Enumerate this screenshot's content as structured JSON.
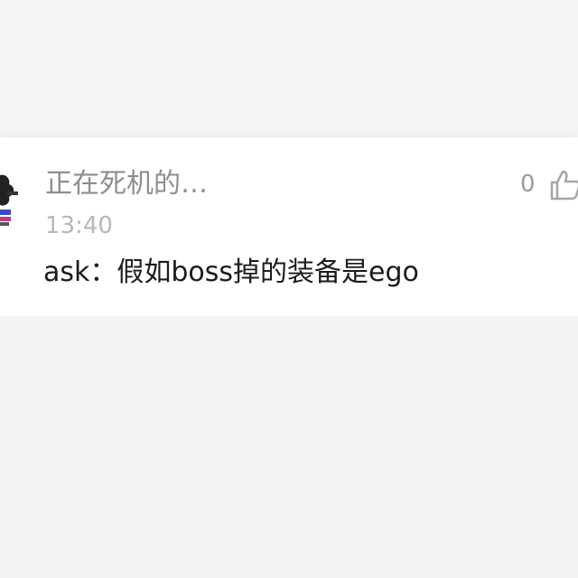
{
  "comment": {
    "username": "正在死机的…",
    "time": "13:40",
    "text": "ask：假如boss掉的装备是ego",
    "likes": "0"
  },
  "icons": {
    "avatar": "avatar",
    "like": "thumbs-up-icon"
  },
  "colors": {
    "background": "#f3f3f6",
    "card": "#ffffff",
    "username": "#8d8d93",
    "timestamp": "#b7b7bd",
    "text": "#1b1b1f"
  }
}
